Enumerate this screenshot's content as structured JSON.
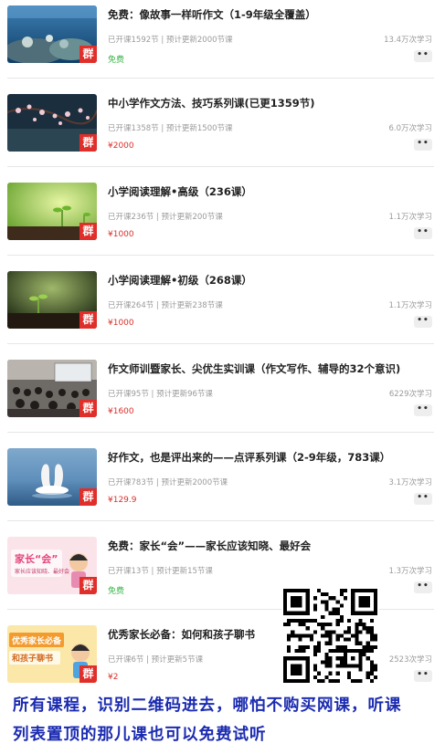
{
  "courses": [
    {
      "title": "免费：像故事一样听作文（1-9年级全覆盖）",
      "meta": "已开课1592节 | 预计更新2000节课",
      "count": "13.4万次学习",
      "price": "免费",
      "free": true,
      "badge": "群",
      "thumb": "ocean-coral"
    },
    {
      "title": "中小学作文方法、技巧系列课(已更1359节)",
      "meta": "已开课1358节 | 预计更新1500节课",
      "count": "6.0万次学习",
      "price": "¥2000",
      "free": false,
      "badge": "群",
      "thumb": "cherry-blossom"
    },
    {
      "title": "小学阅读理解•高级（236课）",
      "meta": "已开课236节 | 预计更新200节课",
      "count": "1.1万次学习",
      "price": "¥1000",
      "free": false,
      "badge": "群",
      "thumb": "green-sprout"
    },
    {
      "title": "小学阅读理解•初级（268课）",
      "meta": "已开课264节 | 预计更新238节课",
      "count": "1.1万次学习",
      "price": "¥1000",
      "free": false,
      "badge": "群",
      "thumb": "dark-sprout"
    },
    {
      "title": "作文师训暨家长、尖优生实训课（作文写作、辅导的32个意识)",
      "meta": "已开课95节 | 预计更新96节课",
      "count": "6229次学习",
      "price": "¥1600",
      "free": false,
      "badge": "群",
      "thumb": "classroom"
    },
    {
      "title": "好作文，也是评出来的——点评系列课（2-9年级，783课）",
      "meta": "已开课783节 | 预计更新2000节课",
      "count": "3.1万次学习",
      "price": "¥129.9",
      "free": false,
      "badge": "群",
      "thumb": "swans"
    },
    {
      "title": "免费：家长“会”——家长应该知晓、最好会",
      "meta": "已开课13节 | 预计更新15节课",
      "count": "1.3万次学习",
      "price": "免费",
      "free": true,
      "badge": "群",
      "thumb": "parent-poster-1",
      "poster_lines": [
        "家长“会”",
        "家长应该知晓、最好会"
      ]
    },
    {
      "title": "优秀家长必备：如何和孩子聊书",
      "meta": "已开课6节 | 预计更新5节课",
      "count": "2523次学习",
      "price": "¥2",
      "free": false,
      "badge": "群",
      "thumb": "parent-poster-2",
      "poster_lines": [
        "优秀家长必备",
        "和孩子聊书"
      ]
    }
  ],
  "more_label": "••",
  "banner": {
    "line1": "所有课程，识别二维码进去，哪怕不购买网课，听课",
    "line2": "列表置顶的那儿课也可以免费试听"
  },
  "colors": {
    "badge": "#e02f2a",
    "price": "#d9302a",
    "free": "#3bb54a",
    "banner_text": "#1b2bb0"
  }
}
